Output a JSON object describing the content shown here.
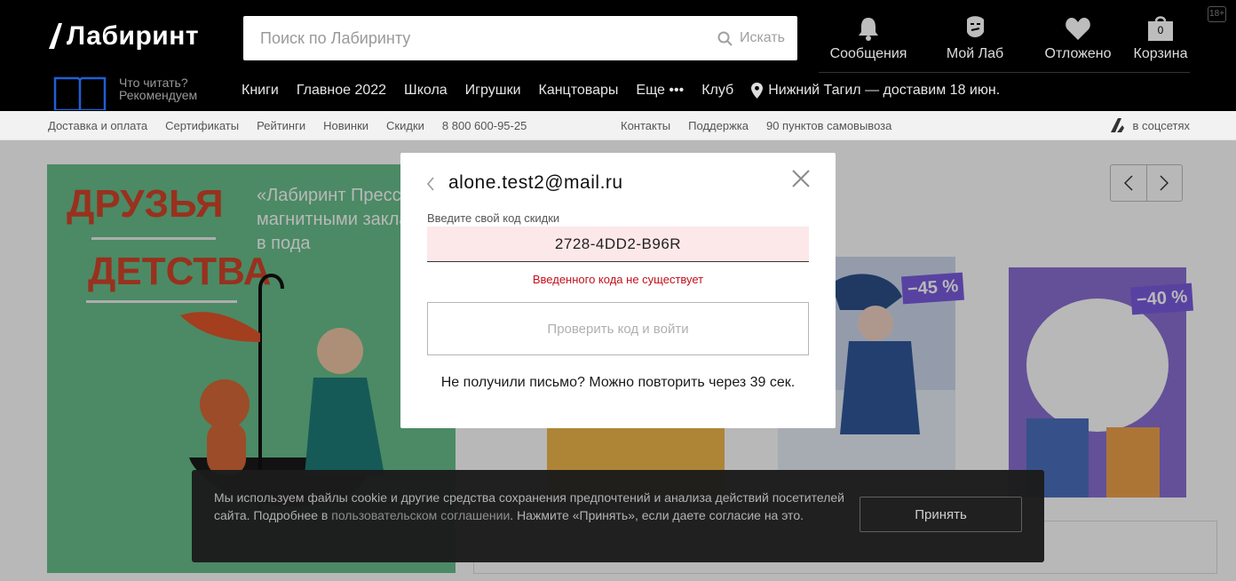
{
  "header": {
    "logo_text": "Лабиринт",
    "search_placeholder": "Поиск по Лабиринту",
    "search_button": "Искать",
    "icons": [
      {
        "label": "Сообщения",
        "icon": "bell-icon"
      },
      {
        "label": "Мой Лаб",
        "icon": "profile-icon"
      },
      {
        "label": "Отложено",
        "icon": "heart-icon"
      },
      {
        "label": "Корзина",
        "icon": "cart-icon",
        "count": "0"
      }
    ],
    "age_badge": "18+",
    "recommend": {
      "line1": "Что читать?",
      "line2": "Рекомендуем"
    },
    "nav": [
      "Книги",
      "Главное 2022",
      "Школа",
      "Игрушки",
      "Канцтовары",
      "Еще •••",
      "Клуб"
    ],
    "location": "Нижний Тагил — доставим 18 июн."
  },
  "subnav": {
    "left": [
      "Доставка и оплата",
      "Сертификаты",
      "Рейтинги",
      "Новинки",
      "Скидки",
      "8 800 600-95-25"
    ],
    "right": [
      "Контакты",
      "Поддержка",
      "90 пунктов самовывоза"
    ],
    "social": "в соцсетях"
  },
  "banner": {
    "title1": "ДРУЗЬЯ",
    "title2": "ДЕТСТВА",
    "subtitle": "«Лабиринт Пресс» с магнитными закладками в пода"
  },
  "books": [
    {
      "discount": "−45 %"
    },
    {
      "discount": "−40 %"
    }
  ],
  "modal": {
    "email": "alone.test2@mail.ru",
    "code_label": "Введите свой код скидки",
    "code_value": "2728-4DD2-B96R",
    "error": "Введенного кода не существует",
    "check_button": "Проверить код и войти",
    "resend_text": "Не получили письмо? Можно повторить через 39 сек."
  },
  "cookie": {
    "text_before": "Мы используем файлы cookie и другие средства сохранения предпочтений и анализа действий посетителей сайта. Подробнее в ",
    "link": "пользовательском соглашении",
    "text_after": ". Нажмите «Принять», если даете согласие на это.",
    "accept": "Принять"
  }
}
